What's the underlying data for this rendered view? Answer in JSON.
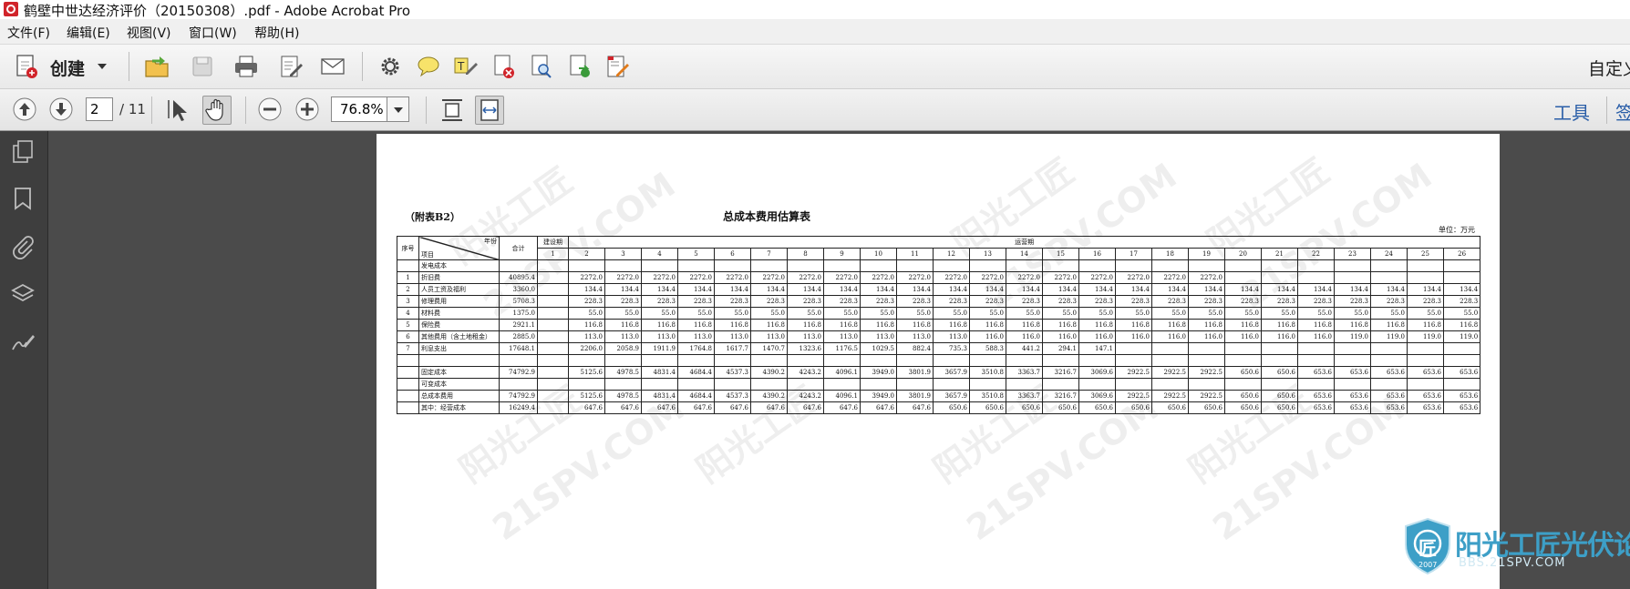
{
  "window": {
    "title": "鹤壁中世达经济评价（20150308）.pdf - Adobe Acrobat Pro"
  },
  "menu": {
    "items": [
      "文件(F)",
      "编辑(E)",
      "视图(V)",
      "窗口(W)",
      "帮助(H)"
    ]
  },
  "toolbar": {
    "create_label": "创建",
    "customize_label": "自定义"
  },
  "nav": {
    "current_page": "2",
    "total_pages": "/ 11",
    "zoom": "76.8%",
    "tools_label": "工具",
    "more_label": "签"
  },
  "document": {
    "label": "（附表B2）",
    "title": "总成本费用估算表",
    "unit": "单位：万元",
    "header": {
      "seq": "序号",
      "item": "项目",
      "year": "年份",
      "total": "合计",
      "construction": "建设期",
      "operation": "运营期",
      "years": [
        "1",
        "2",
        "3",
        "4",
        "5",
        "6",
        "7",
        "8",
        "9",
        "10",
        "11",
        "12",
        "13",
        "14",
        "15",
        "16",
        "17",
        "18",
        "19",
        "20",
        "21",
        "22",
        "23",
        "24",
        "25",
        "26"
      ]
    },
    "rows": [
      {
        "seq": "",
        "item": "发电成本",
        "total": "",
        "c": "",
        "v": []
      },
      {
        "seq": "1",
        "item": "折旧费",
        "total": "40895.4",
        "c": "",
        "v": [
          "2272.0",
          "2272.0",
          "2272.0",
          "2272.0",
          "2272.0",
          "2272.0",
          "2272.0",
          "2272.0",
          "2272.0",
          "2272.0",
          "2272.0",
          "2272.0",
          "2272.0",
          "2272.0",
          "2272.0",
          "2272.0",
          "2272.0",
          "2272.0",
          "",
          "",
          "",
          "",
          "",
          "",
          ""
        ]
      },
      {
        "seq": "2",
        "item": "人员工资及福利",
        "total": "3360.0",
        "c": "",
        "v": [
          "134.4",
          "134.4",
          "134.4",
          "134.4",
          "134.4",
          "134.4",
          "134.4",
          "134.4",
          "134.4",
          "134.4",
          "134.4",
          "134.4",
          "134.4",
          "134.4",
          "134.4",
          "134.4",
          "134.4",
          "134.4",
          "134.4",
          "134.4",
          "134.4",
          "134.4",
          "134.4",
          "134.4",
          "134.4"
        ]
      },
      {
        "seq": "3",
        "item": "修理费用",
        "total": "5708.3",
        "c": "",
        "v": [
          "228.3",
          "228.3",
          "228.3",
          "228.3",
          "228.3",
          "228.3",
          "228.3",
          "228.3",
          "228.3",
          "228.3",
          "228.3",
          "228.3",
          "228.3",
          "228.3",
          "228.3",
          "228.3",
          "228.3",
          "228.3",
          "228.3",
          "228.3",
          "228.3",
          "228.3",
          "228.3",
          "228.3",
          "228.3"
        ]
      },
      {
        "seq": "4",
        "item": "材料费",
        "total": "1375.0",
        "c": "",
        "v": [
          "55.0",
          "55.0",
          "55.0",
          "55.0",
          "55.0",
          "55.0",
          "55.0",
          "55.0",
          "55.0",
          "55.0",
          "55.0",
          "55.0",
          "55.0",
          "55.0",
          "55.0",
          "55.0",
          "55.0",
          "55.0",
          "55.0",
          "55.0",
          "55.0",
          "55.0",
          "55.0",
          "55.0",
          "55.0"
        ]
      },
      {
        "seq": "5",
        "item": "保险费",
        "total": "2921.1",
        "c": "",
        "v": [
          "116.8",
          "116.8",
          "116.8",
          "116.8",
          "116.8",
          "116.8",
          "116.8",
          "116.8",
          "116.8",
          "116.8",
          "116.8",
          "116.8",
          "116.8",
          "116.8",
          "116.8",
          "116.8",
          "116.8",
          "116.8",
          "116.8",
          "116.8",
          "116.8",
          "116.8",
          "116.8",
          "116.8",
          "116.8"
        ]
      },
      {
        "seq": "6",
        "item": "其他费用（含土地租金）",
        "total": "2885.0",
        "c": "",
        "v": [
          "113.0",
          "113.0",
          "113.0",
          "113.0",
          "113.0",
          "113.0",
          "113.0",
          "113.0",
          "113.0",
          "113.0",
          "113.0",
          "116.0",
          "116.0",
          "116.0",
          "116.0",
          "116.0",
          "116.0",
          "116.0",
          "116.0",
          "116.0",
          "116.0",
          "119.0",
          "119.0",
          "119.0",
          "119.0"
        ]
      },
      {
        "seq": "7",
        "item": "利息支出",
        "total": "17648.1",
        "c": "",
        "v": [
          "2206.0",
          "2058.9",
          "1911.9",
          "1764.8",
          "1617.7",
          "1470.7",
          "1323.6",
          "1176.5",
          "1029.5",
          "882.4",
          "735.3",
          "588.3",
          "441.2",
          "294.1",
          "147.1",
          "",
          "",
          "",
          "",
          "",
          "",
          "",
          "",
          "",
          ""
        ]
      },
      {
        "seq": "",
        "item": "",
        "total": "",
        "c": "",
        "v": []
      },
      {
        "seq": "",
        "item": "固定成本",
        "total": "74792.9",
        "c": "",
        "v": [
          "5125.6",
          "4978.5",
          "4831.4",
          "4684.4",
          "4537.3",
          "4390.2",
          "4243.2",
          "4096.1",
          "3949.0",
          "3801.9",
          "3657.9",
          "3510.8",
          "3363.7",
          "3216.7",
          "3069.6",
          "2922.5",
          "2922.5",
          "2922.5",
          "650.6",
          "650.6",
          "653.6",
          "653.6",
          "653.6",
          "653.6",
          "653.6"
        ]
      },
      {
        "seq": "",
        "item": "可变成本",
        "total": "",
        "c": "",
        "v": []
      },
      {
        "seq": "",
        "item": "总成本费用",
        "total": "74792.9",
        "c": "",
        "v": [
          "5125.6",
          "4978.5",
          "4831.4",
          "4684.4",
          "4537.3",
          "4390.2",
          "4243.2",
          "4096.1",
          "3949.0",
          "3801.9",
          "3657.9",
          "3510.8",
          "3363.7",
          "3216.7",
          "3069.6",
          "2922.5",
          "2922.5",
          "2922.5",
          "650.6",
          "650.6",
          "653.6",
          "653.6",
          "653.6",
          "653.6",
          "653.6"
        ]
      },
      {
        "seq": "",
        "item": "其中：经营成本",
        "total": "16249.4",
        "c": "",
        "v": [
          "647.6",
          "647.6",
          "647.6",
          "647.6",
          "647.6",
          "647.6",
          "647.6",
          "647.6",
          "647.6",
          "647.6",
          "650.6",
          "650.6",
          "650.6",
          "650.6",
          "650.6",
          "650.6",
          "650.6",
          "650.6",
          "650.6",
          "650.6",
          "653.6",
          "653.6",
          "653.6",
          "653.6",
          "653.6"
        ]
      }
    ],
    "watermarks": [
      "阳光工匠",
      "21SPV.COM"
    ]
  },
  "logo": {
    "title": "阳光工匠光伏论坛",
    "subtitle": "BBS.21SPV.COM",
    "year": "2007",
    "badge": "匠"
  },
  "colors": {
    "accent": "#2a5ea8",
    "logo": "#3d9fc7"
  }
}
